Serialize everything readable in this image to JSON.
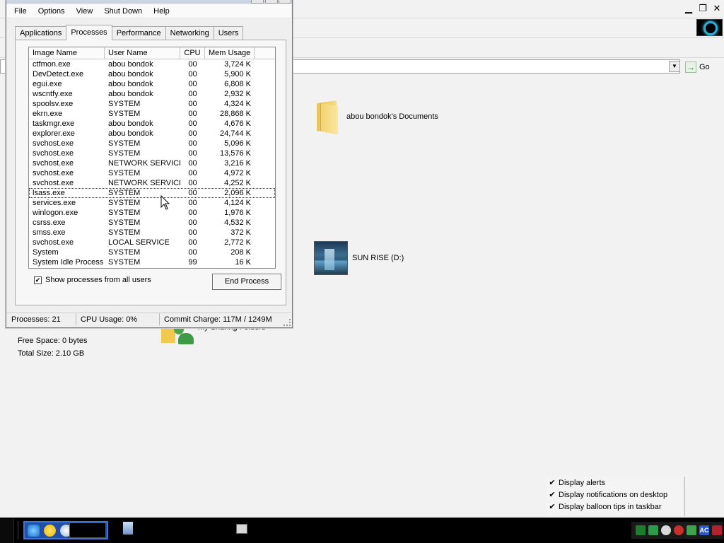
{
  "explorer": {
    "address_go_label": "Go",
    "items": [
      {
        "label": "abou bondok's Documents"
      },
      {
        "label": "SUN RISE (D:)"
      }
    ],
    "details": {
      "free_space": "Free Space: 0 bytes",
      "total_size": "Total Size: 2.10 GB"
    },
    "shared_folders_label": "My Sharing Folders"
  },
  "taskmgr": {
    "menu": [
      "File",
      "Options",
      "View",
      "Shut Down",
      "Help"
    ],
    "tabs": [
      "Applications",
      "Processes",
      "Performance",
      "Networking",
      "Users"
    ],
    "active_tab": "Processes",
    "columns": [
      "Image Name",
      "User Name",
      "CPU",
      "Mem Usage"
    ],
    "processes": [
      {
        "name": "ctfmon.exe",
        "user": "abou bondok",
        "cpu": "00",
        "mem": "3,724 K"
      },
      {
        "name": "DevDetect.exe",
        "user": "abou bondok",
        "cpu": "00",
        "mem": "5,900 K"
      },
      {
        "name": "egui.exe",
        "user": "abou bondok",
        "cpu": "00",
        "mem": "6,808 K"
      },
      {
        "name": "wscntfy.exe",
        "user": "abou bondok",
        "cpu": "00",
        "mem": "2,932 K"
      },
      {
        "name": "spoolsv.exe",
        "user": "SYSTEM",
        "cpu": "00",
        "mem": "4,324 K"
      },
      {
        "name": "ekrn.exe",
        "user": "SYSTEM",
        "cpu": "00",
        "mem": "28,868 K"
      },
      {
        "name": "taskmgr.exe",
        "user": "abou bondok",
        "cpu": "00",
        "mem": "4,676 K"
      },
      {
        "name": "explorer.exe",
        "user": "abou bondok",
        "cpu": "00",
        "mem": "24,744 K"
      },
      {
        "name": "svchost.exe",
        "user": "SYSTEM",
        "cpu": "00",
        "mem": "5,096 K"
      },
      {
        "name": "svchost.exe",
        "user": "SYSTEM",
        "cpu": "00",
        "mem": "13,576 K"
      },
      {
        "name": "svchost.exe",
        "user": "NETWORK SERVICE",
        "cpu": "00",
        "mem": "3,216 K"
      },
      {
        "name": "svchost.exe",
        "user": "SYSTEM",
        "cpu": "00",
        "mem": "4,972 K"
      },
      {
        "name": "svchost.exe",
        "user": "NETWORK SERVICE",
        "cpu": "00",
        "mem": "4,252 K"
      },
      {
        "name": "lsass.exe",
        "user": "SYSTEM",
        "cpu": "00",
        "mem": "2,096 K",
        "selected": true
      },
      {
        "name": "services.exe",
        "user": "SYSTEM",
        "cpu": "00",
        "mem": "4,124 K"
      },
      {
        "name": "winlogon.exe",
        "user": "SYSTEM",
        "cpu": "00",
        "mem": "1,976 K"
      },
      {
        "name": "csrss.exe",
        "user": "SYSTEM",
        "cpu": "00",
        "mem": "4,532 K"
      },
      {
        "name": "smss.exe",
        "user": "SYSTEM",
        "cpu": "00",
        "mem": "372 K"
      },
      {
        "name": "svchost.exe",
        "user": "LOCAL SERVICE",
        "cpu": "00",
        "mem": "2,772 K"
      },
      {
        "name": "System",
        "user": "SYSTEM",
        "cpu": "00",
        "mem": "208 K"
      },
      {
        "name": "System Idle Process",
        "user": "SYSTEM",
        "cpu": "99",
        "mem": "16 K"
      }
    ],
    "show_all_label": "Show processes from all users",
    "show_all_checked": true,
    "end_process_label": "End Process",
    "status": {
      "processes": "Processes: 21",
      "cpu": "CPU Usage: 0%",
      "commit": "Commit Charge: 117M / 1249M"
    }
  },
  "notification_menu": {
    "items": [
      {
        "label": "Display alerts",
        "checked": true
      },
      {
        "label": "Display notifications on desktop",
        "checked": true
      },
      {
        "label": "Display balloon tips in taskbar",
        "checked": true
      }
    ]
  },
  "tray": {
    "ac_label": "AC"
  },
  "colors": {
    "taskbar": "#000000",
    "quick_launch": "#1f4fa8",
    "window_bg": "#efefef"
  }
}
